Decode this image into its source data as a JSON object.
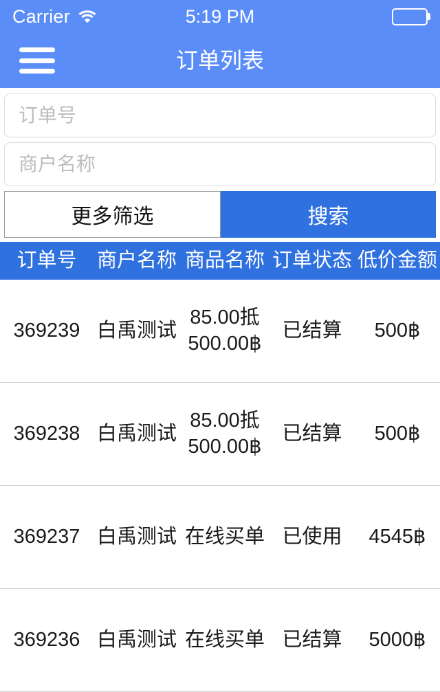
{
  "status_bar": {
    "carrier": "Carrier",
    "wifi_icon": "wifi-icon",
    "time": "5:19 PM",
    "battery_icon": "battery-icon"
  },
  "nav_bar": {
    "menu_icon": "hamburger-menu-icon",
    "title": "订单列表"
  },
  "search_panel": {
    "order_no_input": {
      "value": "",
      "placeholder": "订单号"
    },
    "merchant_input": {
      "value": "",
      "placeholder": "商户名称"
    },
    "more_filter_label": "更多筛选",
    "search_label": "搜索"
  },
  "table": {
    "columns": [
      "订单号",
      "商户名称",
      "商品名称",
      "订单状态",
      "低价金额"
    ],
    "rows": [
      {
        "order_no": "369239",
        "merchant": "白禹测试",
        "goods": "85.00抵500.00฿",
        "status": "已结算",
        "amount": "500฿"
      },
      {
        "order_no": "369238",
        "merchant": "白禹测试",
        "goods": "85.00抵500.00฿",
        "status": "已结算",
        "amount": "500฿"
      },
      {
        "order_no": "369237",
        "merchant": "白禹测试",
        "goods": "在线买单",
        "status": "已使用",
        "amount": "4545฿"
      },
      {
        "order_no": "369236",
        "merchant": "白禹测试",
        "goods": "在线买单",
        "status": "已结算",
        "amount": "5000฿"
      }
    ]
  },
  "colors": {
    "nav_blue": "#5b8df9",
    "accent_blue": "#3071e0",
    "border_gray": "#d2d2d2",
    "placeholder_gray": "#bdbdbd"
  }
}
